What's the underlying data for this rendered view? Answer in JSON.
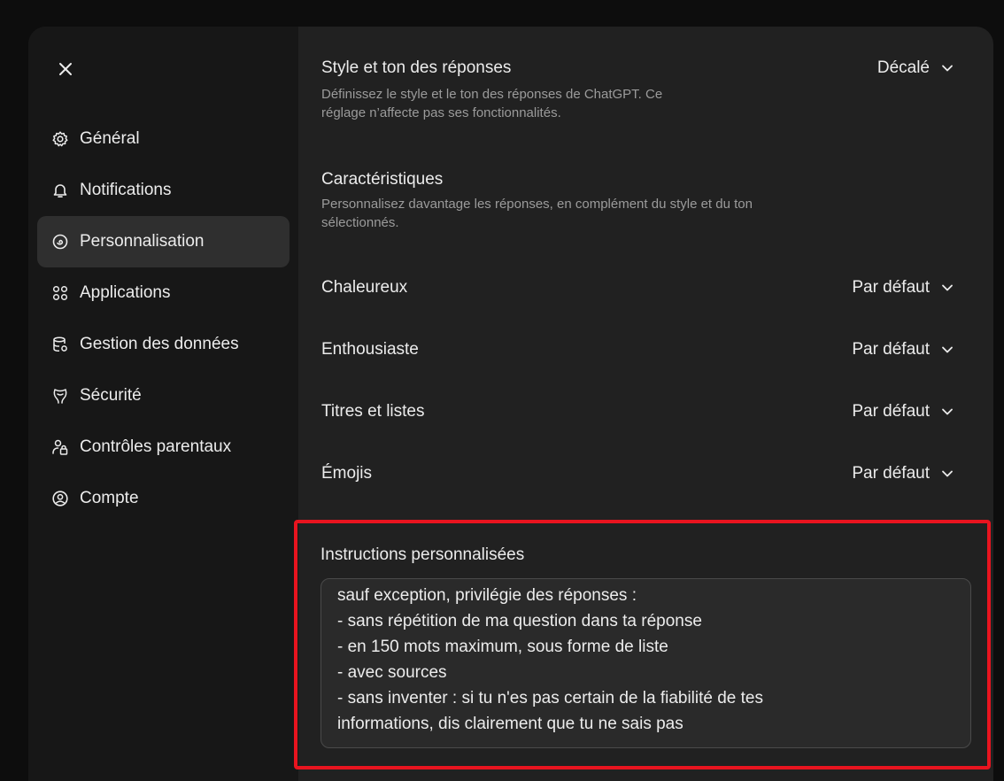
{
  "sidebar": {
    "close_icon": "close-icon",
    "items": [
      {
        "label": "Général",
        "icon": "gear-icon"
      },
      {
        "label": "Notifications",
        "icon": "bell-icon"
      },
      {
        "label": "Personnalisation",
        "icon": "personalization-icon",
        "active": true
      },
      {
        "label": "Applications",
        "icon": "apps-grid-icon"
      },
      {
        "label": "Gestion des données",
        "icon": "database-gear-icon"
      },
      {
        "label": "Sécurité",
        "icon": "security-icon"
      },
      {
        "label": "Contrôles parentaux",
        "icon": "parental-lock-icon"
      },
      {
        "label": "Compte",
        "icon": "account-icon"
      }
    ]
  },
  "main": {
    "style": {
      "title": "Style et ton des réponses",
      "description": "Définissez le style et le ton des réponses de ChatGPT. Ce\nréglage n’affecte pas ses fonctionnalités.",
      "value": "Décalé"
    },
    "characteristics": {
      "title": "Caractéristiques",
      "description": "Personnalisez davantage les réponses, en complément du style et du ton\nsélectionnés."
    },
    "traits": [
      {
        "label": "Chaleureux",
        "value": "Par défaut"
      },
      {
        "label": "Enthousiaste",
        "value": "Par défaut"
      },
      {
        "label": "Titres et listes",
        "value": "Par défaut"
      },
      {
        "label": "Émojis",
        "value": "Par défaut"
      }
    ],
    "custom_instructions": {
      "label": "Instructions personnalisées",
      "value": "sauf exception, privilégie des réponses :\n- sans répétition de ma question dans ta réponse\n- en 150 mots maximum, sous forme de liste\n- avec sources\n- sans inventer : si tu n'es pas certain de la fiabilité de tes\ninformations, dis clairement que tu ne sais pas"
    }
  },
  "colors": {
    "highlight_border": "#e8141f",
    "active_nav_bg": "#2f2f2f"
  }
}
